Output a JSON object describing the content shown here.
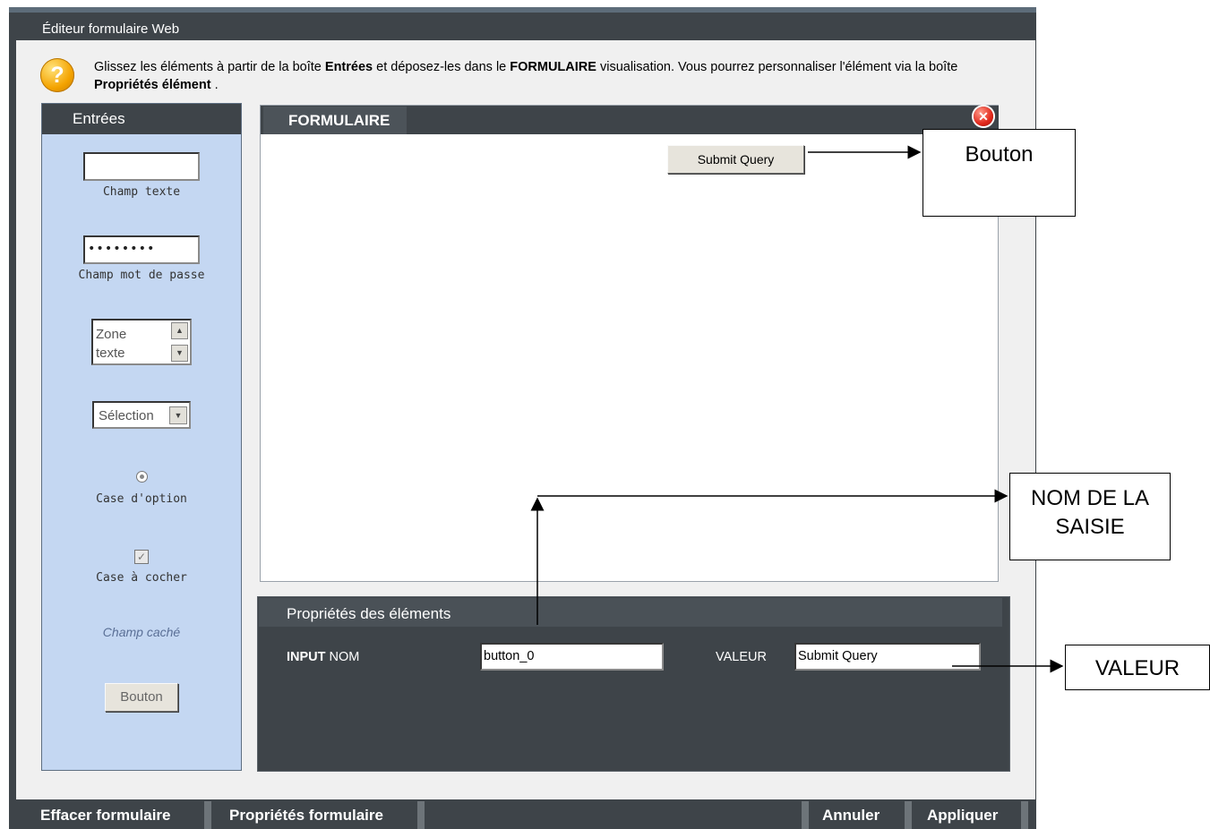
{
  "window": {
    "title": "Éditeur formulaire Web"
  },
  "help": {
    "part1": "Glissez les éléments à partir de la boîte ",
    "bold1": "Entrées",
    "part2": " et déposez-les dans le ",
    "bold2": "FORMULAIRE",
    "part3": " visualisation. Vous pourrez personnaliser l'élément via la boîte ",
    "bold3": "Propriétés élément",
    "part4": " ."
  },
  "inputs_panel": {
    "title": "Entrées",
    "text_field_label": "Champ texte",
    "password_value": "••••••••",
    "password_label": "Champ mot de passe",
    "textarea_value_1": "Zone",
    "textarea_value_2": "texte",
    "select_value": "Sélection",
    "radio_label": "Case d'option",
    "checkbox_label": "Case à cocher",
    "hidden_label": "Champ caché",
    "button_label": "Bouton"
  },
  "form": {
    "title": "FORMULAIRE",
    "submit_button": "Submit Query"
  },
  "properties": {
    "title": "Propriétés des éléments",
    "input_bold": "INPUT",
    "input_name_label": "NOM",
    "name_value": "button_0",
    "value_label": "VALEUR",
    "value_value": "Submit Query"
  },
  "bottom_bar": {
    "clear": "Effacer formulaire",
    "form_props": "Propriétés formulaire",
    "cancel": "Annuler",
    "apply": "Appliquer"
  },
  "annotations": {
    "button": "Bouton",
    "name_line1": "NOM DE LA",
    "name_line2": "SAISIE",
    "value": "VALEUR"
  },
  "colors": {
    "chrome": "#3e4449",
    "panel_bg": "#c4d7f2",
    "body_bg": "#f0f0f0"
  }
}
